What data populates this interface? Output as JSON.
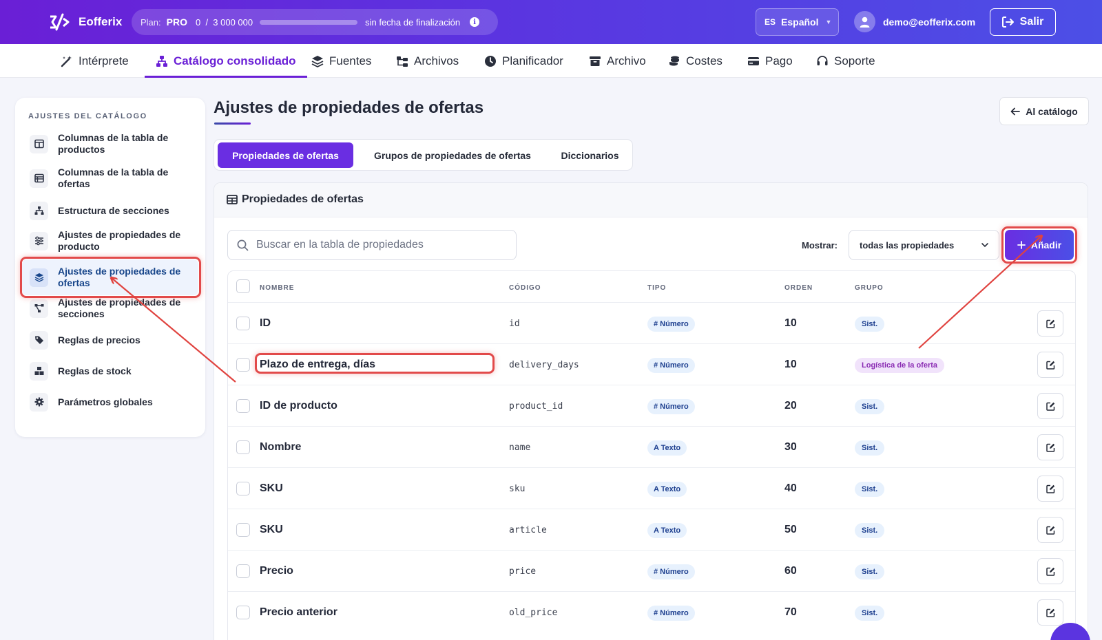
{
  "app": {
    "name": "Eofferix"
  },
  "plan": {
    "label": "Plan:",
    "tier": "PRO",
    "usage": "0  /  3 000 000",
    "usage_fraction": 0,
    "expiry": "sin fecha de finalización",
    "info_glyph": "i"
  },
  "language": {
    "code": "ES",
    "label": "Español"
  },
  "user": {
    "email": "demo@eofferix.com"
  },
  "logout": {
    "label": "Salir"
  },
  "nav": {
    "items": [
      {
        "label": "Intérprete",
        "icon": "wand-icon"
      },
      {
        "label": "Catálogo consolidado",
        "icon": "sitemap-icon"
      },
      {
        "label": "Fuentes",
        "icon": "layers-icon"
      },
      {
        "label": "Archivos",
        "icon": "folder-tree-icon"
      },
      {
        "label": "Planificador",
        "icon": "clock-icon"
      },
      {
        "label": "Archivo",
        "icon": "archive-icon"
      },
      {
        "label": "Costes",
        "icon": "coins-icon"
      },
      {
        "label": "Pago",
        "icon": "credit-card-icon"
      },
      {
        "label": "Soporte",
        "icon": "headset-icon"
      }
    ]
  },
  "sidebar": {
    "title": "AJUSTES DEL CATÁLOGO",
    "items": [
      {
        "label": "Columnas de la tabla de productos",
        "icon": "columns-icon"
      },
      {
        "label": "Columnas de la tabla de ofertas",
        "icon": "table-list-icon"
      },
      {
        "label": "Estructura de secciones",
        "icon": "sitemap-icon"
      },
      {
        "label": "Ajustes de propiedades de producto",
        "icon": "sliders-icon"
      },
      {
        "label": "Ajustes de propiedades de ofertas",
        "icon": "layers-icon"
      },
      {
        "label": "Ajustes de propiedades de secciones",
        "icon": "diagram-icon"
      },
      {
        "label": "Reglas de precios",
        "icon": "tags-icon"
      },
      {
        "label": "Reglas de stock",
        "icon": "boxes-icon"
      },
      {
        "label": "Parámetros globales",
        "icon": "gear-icon"
      }
    ]
  },
  "page": {
    "title": "Ajustes de propiedades de ofertas",
    "back_label": "Al catálogo"
  },
  "tabs": [
    {
      "label": "Propiedades de ofertas"
    },
    {
      "label": "Grupos de propiedades de ofertas"
    },
    {
      "label": "Diccionarios"
    }
  ],
  "panel": {
    "title": "Propiedades de ofertas",
    "search_placeholder": "Buscar en la tabla de propiedades",
    "show_label": "Mostrar:",
    "show_value": "todas las propiedades",
    "add_label": "Añadir"
  },
  "table": {
    "columns": {
      "name": "NOMBRE",
      "code": "CÓDIGO",
      "type": "TIPO",
      "order": "ORDEN",
      "group": "GRUPO"
    },
    "rows": [
      {
        "name": "ID",
        "code": "id",
        "type": "# Número",
        "order": "10",
        "group": "Sist."
      },
      {
        "name": "Plazo de entrega, días",
        "code": "delivery_days",
        "type": "# Número",
        "order": "10",
        "group": "Logística de la oferta"
      },
      {
        "name": "ID de producto",
        "code": "product_id",
        "type": "# Número",
        "order": "20",
        "group": "Sist."
      },
      {
        "name": "Nombre",
        "code": "name",
        "type": "A Texto",
        "order": "30",
        "group": "Sist."
      },
      {
        "name": "SKU",
        "code": "sku",
        "type": "A Texto",
        "order": "40",
        "group": "Sist."
      },
      {
        "name": "SKU",
        "code": "article",
        "type": "A Texto",
        "order": "50",
        "group": "Sist."
      },
      {
        "name": "Precio",
        "code": "price",
        "type": "# Número",
        "order": "60",
        "group": "Sist."
      },
      {
        "name": "Precio anterior",
        "code": "old_price",
        "type": "# Número",
        "order": "70",
        "group": "Sist."
      }
    ]
  },
  "colors": {
    "accent": "#6a2ee2",
    "highlight": "#e24a4a"
  }
}
